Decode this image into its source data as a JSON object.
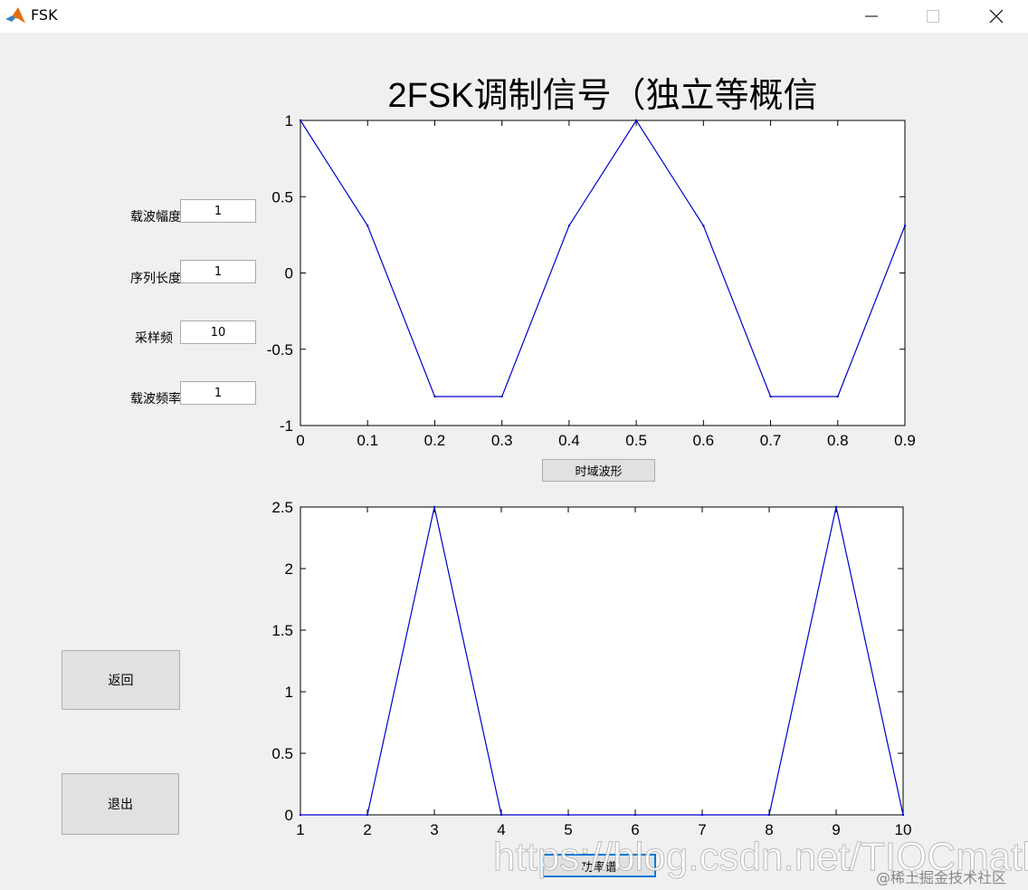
{
  "window": {
    "title": "FSK",
    "icon": "matlab-icon",
    "controls": [
      "minimize-icon",
      "maximize-icon",
      "close-icon"
    ]
  },
  "params": [
    {
      "label": "载波幅度",
      "value": "1"
    },
    {
      "label": "序列长度",
      "value": "1"
    },
    {
      "label": "采样频",
      "value": "10"
    },
    {
      "label": "载波频率",
      "value": "1"
    }
  ],
  "buttons": {
    "back": "返回",
    "exit": "退出",
    "time_wave": "时域波形",
    "spectrum": "功率谱"
  },
  "colors": {
    "line": "#0000cc",
    "background": "#f0f0f0",
    "focus": "#0078d7"
  },
  "watermark": {
    "main": "https://blog.csdn.net/TIQCmatlab",
    "sub": "@稀土掘金技术社区"
  },
  "chart_data": [
    {
      "type": "line",
      "title": "2FSK调制信号（独立等概信",
      "x": [
        0,
        0.1,
        0.2,
        0.3,
        0.4,
        0.5,
        0.6,
        0.7,
        0.8,
        0.9
      ],
      "series": [
        {
          "values": [
            1,
            0.31,
            -0.81,
            -0.81,
            0.31,
            1,
            0.31,
            -0.81,
            -0.81,
            0.31
          ]
        }
      ],
      "xlim": [
        0,
        0.9
      ],
      "ylim": [
        -1,
        1
      ],
      "xticks": [
        0,
        0.1,
        0.2,
        0.3,
        0.4,
        0.5,
        0.6,
        0.7,
        0.8,
        0.9
      ],
      "xtick_labels": [
        "0",
        "0.1",
        "0.2",
        "0.3",
        "0.4",
        "0.5",
        "0.6",
        "0.7",
        "0.8",
        "0.9"
      ],
      "yticks": [
        -1,
        -0.5,
        0,
        0.5,
        1
      ],
      "ytick_labels": [
        "-1",
        "-0.5",
        "0",
        "0.5",
        "1"
      ],
      "grid": false
    },
    {
      "type": "line",
      "x": [
        1,
        2,
        3,
        4,
        5,
        6,
        7,
        8,
        9,
        10
      ],
      "series": [
        {
          "values": [
            0,
            0,
            2.5,
            0,
            0,
            0,
            0,
            0,
            2.5,
            0
          ]
        }
      ],
      "xlim": [
        1,
        10
      ],
      "ylim": [
        0,
        2.5
      ],
      "xticks": [
        1,
        2,
        3,
        4,
        5,
        6,
        7,
        8,
        9,
        10
      ],
      "xtick_labels": [
        "1",
        "2",
        "3",
        "4",
        "5",
        "6",
        "7",
        "8",
        "9",
        "10"
      ],
      "yticks": [
        0,
        0.5,
        1,
        1.5,
        2,
        2.5
      ],
      "ytick_labels": [
        "0",
        "0.5",
        "1",
        "1.5",
        "2",
        "2.5"
      ],
      "grid": false
    }
  ]
}
